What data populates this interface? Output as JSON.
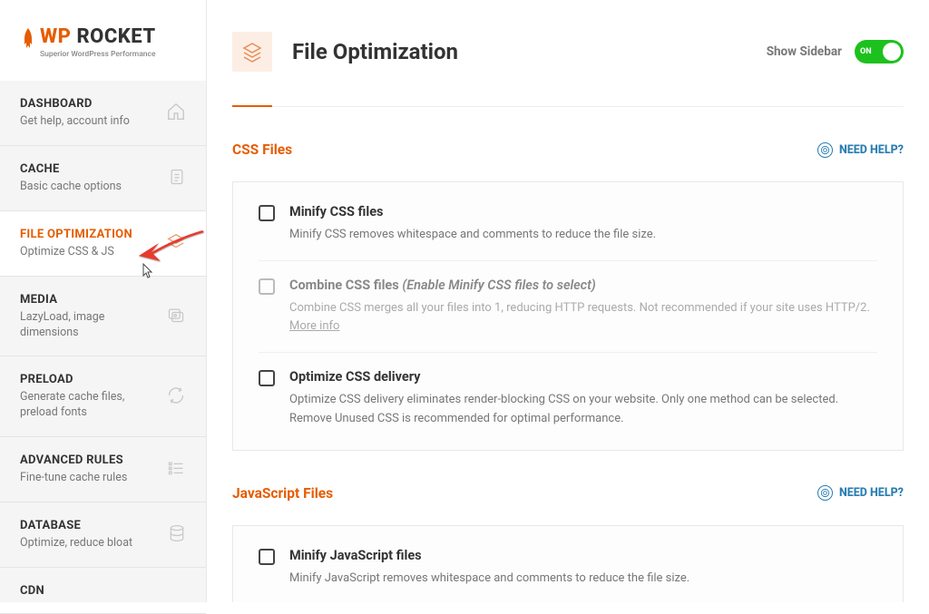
{
  "logo": {
    "orange": "WP",
    "black": "ROCKET",
    "sub": "Superior WordPress Performance"
  },
  "nav": {
    "items": [
      {
        "title": "DASHBOARD",
        "desc": "Get help, account info"
      },
      {
        "title": "CACHE",
        "desc": "Basic cache options"
      },
      {
        "title": "FILE OPTIMIZATION",
        "desc": "Optimize CSS & JS"
      },
      {
        "title": "MEDIA",
        "desc": "LazyLoad, image dimensions"
      },
      {
        "title": "PRELOAD",
        "desc": "Generate cache files, preload fonts"
      },
      {
        "title": "ADVANCED RULES",
        "desc": "Fine-tune cache rules"
      },
      {
        "title": "DATABASE",
        "desc": "Optimize, reduce bloat"
      },
      {
        "title": "CDN",
        "desc": ""
      }
    ]
  },
  "header": {
    "title": "File Optimization",
    "show_sidebar": "Show Sidebar",
    "toggle": "ON"
  },
  "help": "NEED HELP?",
  "sections": {
    "css": {
      "title": "CSS Files",
      "options": [
        {
          "title": "Minify CSS files",
          "desc": "Minify CSS removes whitespace and comments to reduce the file size."
        },
        {
          "title": "Combine CSS files",
          "hint": "(Enable Minify CSS files to select)",
          "desc": "Combine CSS merges all your files into 1, reducing HTTP requests. Not recommended if your site uses HTTP/2. ",
          "more": "More info"
        },
        {
          "title": "Optimize CSS delivery",
          "desc": "Optimize CSS delivery eliminates render-blocking CSS on your website. Only one method can be selected. Remove Unused CSS is recommended for optimal performance."
        }
      ]
    },
    "js": {
      "title": "JavaScript Files",
      "options": [
        {
          "title": "Minify JavaScript files",
          "desc": "Minify JavaScript removes whitespace and comments to reduce the file size."
        }
      ]
    }
  }
}
